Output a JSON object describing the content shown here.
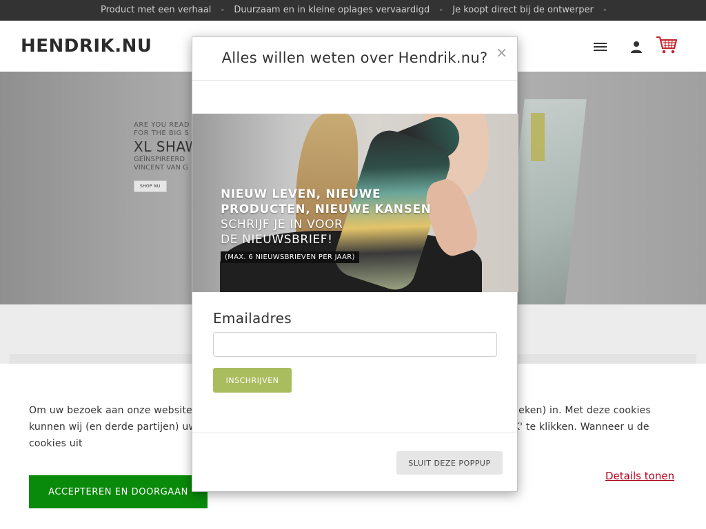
{
  "topbar": {
    "items": [
      "Product met een verhaal",
      "Duurzaam en in kleine oplages vervaardigd",
      "Je koopt direct bij de ontwerper"
    ],
    "separator": "-"
  },
  "header": {
    "logo": "HENDRIK.NU",
    "icons": [
      "menu-icon",
      "user-icon",
      "shopping-cart-icon"
    ]
  },
  "hero": {
    "small_line1": "ARE YOU READ",
    "small_line2": "FOR THE BIG S",
    "headline": "XL SHAW",
    "sub_line1": "GEÏNSPIREERD",
    "sub_line2": "VINCENT VAN G",
    "button": "SHOP NU"
  },
  "cookie": {
    "text": "Om uw bezoek aan onze website makkelijker te maken, zetten wij cookies (en vergelijkbare technieken) in. Met deze cookies kunnen wij (en derde partijen) uw surfgedrag volgen. U kunt deze cookies accepteren door op: 'OK' te klikken. Wanneer u de cookies uit",
    "accept": "ACCEPTEREN EN DOORGAAN",
    "details": "Details tonen",
    "colors": {
      "accept_bg": "#0a8a0a",
      "details_link": "#b3001b"
    }
  },
  "modal": {
    "title": "Alles willen weten over Hendrik.nu?",
    "close_symbol": "×",
    "image_text": {
      "line1": "NIEUW LEVEN, NIEUWE",
      "line2": "PRODUCTEN, NIEUWE KANSEN",
      "line3": "SCHRIJF JE IN VOOR",
      "line4": "DE NIEUWSBRIEF!",
      "small": "(MAX. 6 NIEUWSBRIEVEN PER JAAR)"
    },
    "email_label": "Emailadres",
    "email_value": "",
    "subscribe": "INSCHRIJVEN",
    "close_popup": "SLUIT DEZE POPPUP",
    "colors": {
      "subscribe_bg": "#a9bd5f"
    }
  }
}
